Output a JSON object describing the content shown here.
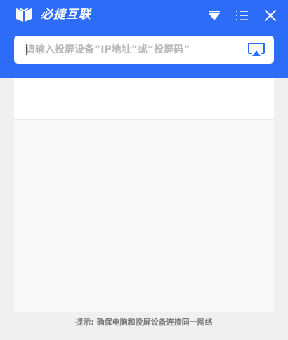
{
  "app": {
    "title": "必捷互联",
    "logo_icon": "book-logo-icon",
    "accent_color": "#2d6cf6"
  },
  "header": {
    "buttons": [
      {
        "icon": "filter-funnel-icon"
      },
      {
        "icon": "menu-list-icon"
      },
      {
        "icon": "close-icon"
      }
    ]
  },
  "search": {
    "placeholder": "请输入投屏设备“IP地址”或“投屏码”",
    "value": "",
    "cast_icon": "screen-cast-icon"
  },
  "footer": {
    "hint": "提示: 确保电脑和投屏设备连接同一网络"
  }
}
